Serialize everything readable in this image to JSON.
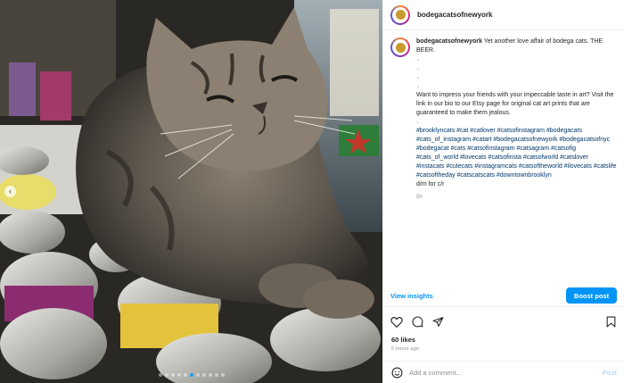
{
  "post": {
    "username": "bodegacatsofnewyork",
    "caption_line1": "Yet another love affair of bodega cats. THE BEER.",
    "caption_dots": [
      ".",
      ".",
      ".",
      "."
    ],
    "caption_paragraph": "Want to impress your friends with your impeccable taste in art? Visit the link in our bio to our Etsy page for original cat art prints that are guaranteed to make them jealous.",
    "caption_dot_after": ".",
    "hashtags": "#brooklyncats #cat #catlover #catsofinstagram #bodegacats #cats_of_instagram #catart #bodegacatsofnewyork #bodegacatsofnyc #bodegacat #cats #catsofinstagram #catsagram #catsofig #cats_of_world #lovecats #catsofinsta #catsofworld #catslover #instacats #cutecats #instagramcats #catsoftheworld #ilovecats #catslife #catsoftheday #catscatscats #downtownbrooklyn",
    "credit": "d/m for c/r",
    "comment_time": "5h",
    "likes": "60 likes",
    "time_ago": "5 hours ago"
  },
  "actions": {
    "view_insights": "View insights",
    "boost_post": "Boost post",
    "comment_placeholder": "Add a comment...",
    "post_button": "Post"
  },
  "icons": {
    "like": "heart-icon",
    "comment": "comment-icon",
    "share": "share-icon",
    "save": "bookmark-icon",
    "emoji": "emoji-icon",
    "carousel_prev": "chevron-left-icon"
  },
  "carousel": {
    "total": 11,
    "active_index": 5
  },
  "colors": {
    "accent": "#0095f6",
    "hashtag": "#00376b",
    "muted": "#8e8e8e"
  }
}
